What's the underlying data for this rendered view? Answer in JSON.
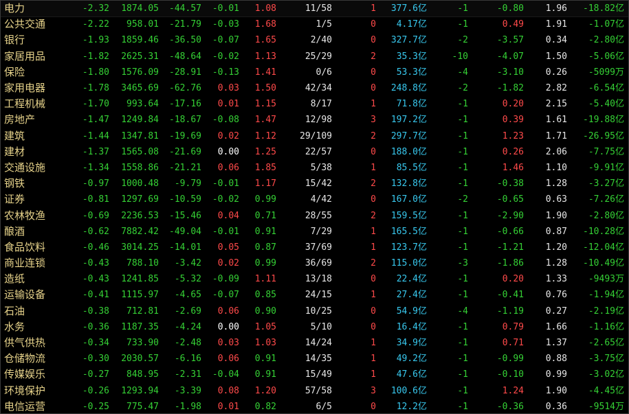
{
  "colors": {
    "up": "#ff4a4a",
    "down": "#35d135",
    "amount": "#38c8ee",
    "name": "#e6d28a",
    "background": "#000000"
  },
  "rows": [
    {
      "name": "电力",
      "pct": "-2.32",
      "index": "1874.05",
      "chg": "-44.57",
      "speed": "-0.01",
      "ratio": "1.08",
      "updown": "11/58",
      "lead": "1",
      "amount": "377.6亿",
      "v8": "-1",
      "v9": "-0.80",
      "v10": "1.96",
      "v11": "-18.82亿",
      "speedColor": "down",
      "ratioColor": "up",
      "v9Color": "down",
      "leadColor": "up",
      "v11Color": "down"
    },
    {
      "name": "公共交通",
      "pct": "-2.22",
      "index": "958.01",
      "chg": "-21.79",
      "speed": "-0.03",
      "ratio": "1.68",
      "updown": "1/5",
      "lead": "0",
      "amount": "4.17亿",
      "v8": "-1",
      "v9": "0.49",
      "v10": "1.91",
      "v11": "-1.07亿",
      "speedColor": "down",
      "ratioColor": "up",
      "v9Color": "up",
      "leadColor": "up",
      "v11Color": "down"
    },
    {
      "name": "银行",
      "pct": "-1.93",
      "index": "1859.46",
      "chg": "-36.50",
      "speed": "-0.07",
      "ratio": "1.65",
      "updown": "2/40",
      "lead": "0",
      "amount": "327.7亿",
      "v8": "-2",
      "v9": "-3.57",
      "v10": "0.34",
      "v11": "-2.80亿",
      "speedColor": "down",
      "ratioColor": "up",
      "v9Color": "down",
      "leadColor": "up",
      "v11Color": "down"
    },
    {
      "name": "家居用品",
      "pct": "-1.82",
      "index": "2625.31",
      "chg": "-48.64",
      "speed": "-0.02",
      "ratio": "1.13",
      "updown": "25/29",
      "lead": "2",
      "amount": "35.3亿",
      "v8": "-10",
      "v9": "-4.07",
      "v10": "1.50",
      "v11": "-5.06亿",
      "speedColor": "down",
      "ratioColor": "up",
      "v9Color": "down",
      "leadColor": "up",
      "v11Color": "down"
    },
    {
      "name": "保险",
      "pct": "-1.80",
      "index": "1576.09",
      "chg": "-28.91",
      "speed": "-0.13",
      "ratio": "1.41",
      "updown": "0/6",
      "lead": "0",
      "amount": "53.3亿",
      "v8": "-4",
      "v9": "-3.10",
      "v10": "0.26",
      "v11": "-5099万",
      "speedColor": "down",
      "ratioColor": "up",
      "v9Color": "down",
      "leadColor": "up",
      "v11Color": "down"
    },
    {
      "name": "家用电器",
      "pct": "-1.78",
      "index": "3465.69",
      "chg": "-62.76",
      "speed": "0.03",
      "ratio": "1.50",
      "updown": "42/34",
      "lead": "0",
      "amount": "248.8亿",
      "v8": "-2",
      "v9": "-1.82",
      "v10": "2.82",
      "v11": "-6.54亿",
      "speedColor": "up",
      "ratioColor": "up",
      "v9Color": "down",
      "leadColor": "up",
      "v11Color": "down"
    },
    {
      "name": "工程机械",
      "pct": "-1.70",
      "index": "993.64",
      "chg": "-17.16",
      "speed": "0.01",
      "ratio": "1.15",
      "updown": "8/17",
      "lead": "1",
      "amount": "71.8亿",
      "v8": "-1",
      "v9": "0.20",
      "v10": "2.15",
      "v11": "-5.40亿",
      "speedColor": "up",
      "ratioColor": "up",
      "v9Color": "up",
      "leadColor": "up",
      "v11Color": "down"
    },
    {
      "name": "房地产",
      "pct": "-1.47",
      "index": "1249.84",
      "chg": "-18.67",
      "speed": "-0.08",
      "ratio": "1.47",
      "updown": "12/98",
      "lead": "3",
      "amount": "197.2亿",
      "v8": "-1",
      "v9": "0.39",
      "v10": "1.61",
      "v11": "-19.88亿",
      "speedColor": "down",
      "ratioColor": "up",
      "v9Color": "up",
      "leadColor": "up",
      "v11Color": "down"
    },
    {
      "name": "建筑",
      "pct": "-1.44",
      "index": "1347.81",
      "chg": "-19.69",
      "speed": "0.02",
      "ratio": "1.12",
      "updown": "29/109",
      "lead": "2",
      "amount": "297.7亿",
      "v8": "-1",
      "v9": "1.23",
      "v10": "1.71",
      "v11": "-26.95亿",
      "speedColor": "up",
      "ratioColor": "up",
      "v9Color": "up",
      "leadColor": "up",
      "v11Color": "down"
    },
    {
      "name": "建材",
      "pct": "-1.37",
      "index": "1565.08",
      "chg": "-21.69",
      "speed": "0.00",
      "ratio": "1.25",
      "updown": "22/57",
      "lead": "0",
      "amount": "188.0亿",
      "v8": "-1",
      "v9": "0.26",
      "v10": "2.06",
      "v11": "-7.75亿",
      "speedColor": "flat",
      "ratioColor": "up",
      "v9Color": "up",
      "leadColor": "up",
      "v11Color": "down"
    },
    {
      "name": "交通设施",
      "pct": "-1.34",
      "index": "1558.86",
      "chg": "-21.21",
      "speed": "0.06",
      "ratio": "1.85",
      "updown": "5/38",
      "lead": "1",
      "amount": "85.5亿",
      "v8": "-1",
      "v9": "1.46",
      "v10": "1.10",
      "v11": "-9.91亿",
      "speedColor": "up",
      "ratioColor": "up",
      "v9Color": "up",
      "leadColor": "up",
      "v11Color": "down"
    },
    {
      "name": "钢铁",
      "pct": "-0.97",
      "index": "1000.48",
      "chg": "-9.79",
      "speed": "-0.01",
      "ratio": "1.17",
      "updown": "15/42",
      "lead": "2",
      "amount": "132.8亿",
      "v8": "-1",
      "v9": "-0.38",
      "v10": "1.28",
      "v11": "-3.27亿",
      "speedColor": "down",
      "ratioColor": "up",
      "v9Color": "down",
      "leadColor": "up",
      "v11Color": "down"
    },
    {
      "name": "证券",
      "pct": "-0.81",
      "index": "1297.69",
      "chg": "-10.59",
      "speed": "-0.02",
      "ratio": "0.99",
      "updown": "4/42",
      "lead": "0",
      "amount": "167.0亿",
      "v8": "-2",
      "v9": "-0.65",
      "v10": "0.63",
      "v11": "-7.26亿",
      "speedColor": "down",
      "ratioColor": "down",
      "v9Color": "down",
      "leadColor": "up",
      "v11Color": "down"
    },
    {
      "name": "农林牧渔",
      "pct": "-0.69",
      "index": "2236.53",
      "chg": "-15.46",
      "speed": "0.04",
      "ratio": "0.71",
      "updown": "28/55",
      "lead": "2",
      "amount": "159.5亿",
      "v8": "-1",
      "v9": "-2.90",
      "v10": "1.90",
      "v11": "-2.80亿",
      "speedColor": "up",
      "ratioColor": "down",
      "v9Color": "down",
      "leadColor": "up",
      "v11Color": "down"
    },
    {
      "name": "酿酒",
      "pct": "-0.62",
      "index": "7882.42",
      "chg": "-49.04",
      "speed": "-0.01",
      "ratio": "0.91",
      "updown": "7/29",
      "lead": "1",
      "amount": "165.5亿",
      "v8": "-1",
      "v9": "-0.66",
      "v10": "0.87",
      "v11": "-10.28亿",
      "speedColor": "down",
      "ratioColor": "down",
      "v9Color": "down",
      "leadColor": "up",
      "v11Color": "down"
    },
    {
      "name": "食品饮料",
      "pct": "-0.46",
      "index": "3014.25",
      "chg": "-14.01",
      "speed": "0.05",
      "ratio": "0.87",
      "updown": "37/69",
      "lead": "1",
      "amount": "123.7亿",
      "v8": "-1",
      "v9": "-1.21",
      "v10": "1.20",
      "v11": "-12.04亿",
      "speedColor": "up",
      "ratioColor": "down",
      "v9Color": "down",
      "leadColor": "up",
      "v11Color": "down"
    },
    {
      "name": "商业连锁",
      "pct": "-0.43",
      "index": "788.10",
      "chg": "-3.42",
      "speed": "0.02",
      "ratio": "0.99",
      "updown": "36/69",
      "lead": "2",
      "amount": "115.0亿",
      "v8": "-3",
      "v9": "-1.86",
      "v10": "1.28",
      "v11": "-10.49亿",
      "speedColor": "up",
      "ratioColor": "down",
      "v9Color": "down",
      "leadColor": "up",
      "v11Color": "down"
    },
    {
      "name": "造纸",
      "pct": "-0.43",
      "index": "1241.85",
      "chg": "-5.32",
      "speed": "-0.09",
      "ratio": "1.11",
      "updown": "13/18",
      "lead": "0",
      "amount": "22.4亿",
      "v8": "-1",
      "v9": "0.20",
      "v10": "1.33",
      "v11": "-9493万",
      "speedColor": "down",
      "ratioColor": "up",
      "v9Color": "up",
      "leadColor": "up",
      "v11Color": "down"
    },
    {
      "name": "运输设备",
      "pct": "-0.41",
      "index": "1115.97",
      "chg": "-4.65",
      "speed": "-0.07",
      "ratio": "0.85",
      "updown": "24/15",
      "lead": "1",
      "amount": "27.4亿",
      "v8": "-1",
      "v9": "-0.41",
      "v10": "0.76",
      "v11": "-1.94亿",
      "speedColor": "down",
      "ratioColor": "down",
      "v9Color": "down",
      "leadColor": "up",
      "v11Color": "down"
    },
    {
      "name": "石油",
      "pct": "-0.38",
      "index": "712.81",
      "chg": "-2.69",
      "speed": "0.06",
      "ratio": "0.90",
      "updown": "10/25",
      "lead": "0",
      "amount": "54.9亿",
      "v8": "-4",
      "v9": "-1.19",
      "v10": "0.27",
      "v11": "-2.19亿",
      "speedColor": "up",
      "ratioColor": "down",
      "v9Color": "down",
      "leadColor": "up",
      "v11Color": "down"
    },
    {
      "name": "水务",
      "pct": "-0.36",
      "index": "1187.35",
      "chg": "-4.24",
      "speed": "0.00",
      "ratio": "1.05",
      "updown": "5/10",
      "lead": "0",
      "amount": "16.4亿",
      "v8": "-1",
      "v9": "0.79",
      "v10": "1.66",
      "v11": "-1.16亿",
      "speedColor": "flat",
      "ratioColor": "up",
      "v9Color": "up",
      "leadColor": "up",
      "v11Color": "down"
    },
    {
      "name": "供气供热",
      "pct": "-0.34",
      "index": "733.90",
      "chg": "-2.48",
      "speed": "0.03",
      "ratio": "1.03",
      "updown": "14/24",
      "lead": "1",
      "amount": "34.9亿",
      "v8": "-1",
      "v9": "0.71",
      "v10": "1.37",
      "v11": "-2.65亿",
      "speedColor": "up",
      "ratioColor": "up",
      "v9Color": "up",
      "leadColor": "up",
      "v11Color": "down"
    },
    {
      "name": "仓储物流",
      "pct": "-0.30",
      "index": "2030.57",
      "chg": "-6.16",
      "speed": "0.06",
      "ratio": "0.91",
      "updown": "14/35",
      "lead": "1",
      "amount": "49.2亿",
      "v8": "-1",
      "v9": "-0.99",
      "v10": "0.88",
      "v11": "-3.75亿",
      "speedColor": "up",
      "ratioColor": "down",
      "v9Color": "down",
      "leadColor": "up",
      "v11Color": "down"
    },
    {
      "name": "传媒娱乐",
      "pct": "-0.27",
      "index": "848.95",
      "chg": "-2.31",
      "speed": "-0.04",
      "ratio": "0.91",
      "updown": "15/49",
      "lead": "1",
      "amount": "47.6亿",
      "v8": "-1",
      "v9": "-0.10",
      "v10": "0.99",
      "v11": "-3.02亿",
      "speedColor": "down",
      "ratioColor": "down",
      "v9Color": "down",
      "leadColor": "up",
      "v11Color": "down"
    },
    {
      "name": "环境保护",
      "pct": "-0.26",
      "index": "1293.94",
      "chg": "-3.39",
      "speed": "0.08",
      "ratio": "1.20",
      "updown": "57/58",
      "lead": "3",
      "amount": "100.6亿",
      "v8": "-1",
      "v9": "1.24",
      "v10": "1.90",
      "v11": "-4.45亿",
      "speedColor": "up",
      "ratioColor": "up",
      "v9Color": "up",
      "leadColor": "up",
      "v11Color": "down"
    },
    {
      "name": "电信运营",
      "pct": "-0.25",
      "index": "775.47",
      "chg": "-1.98",
      "speed": "0.01",
      "ratio": "0.82",
      "updown": "6/5",
      "lead": "0",
      "amount": "12.2亿",
      "v8": "-1",
      "v9": "-0.36",
      "v10": "0.36",
      "v11": "-9514万",
      "speedColor": "up",
      "ratioColor": "down",
      "v9Color": "down",
      "leadColor": "up",
      "v11Color": "down"
    }
  ]
}
